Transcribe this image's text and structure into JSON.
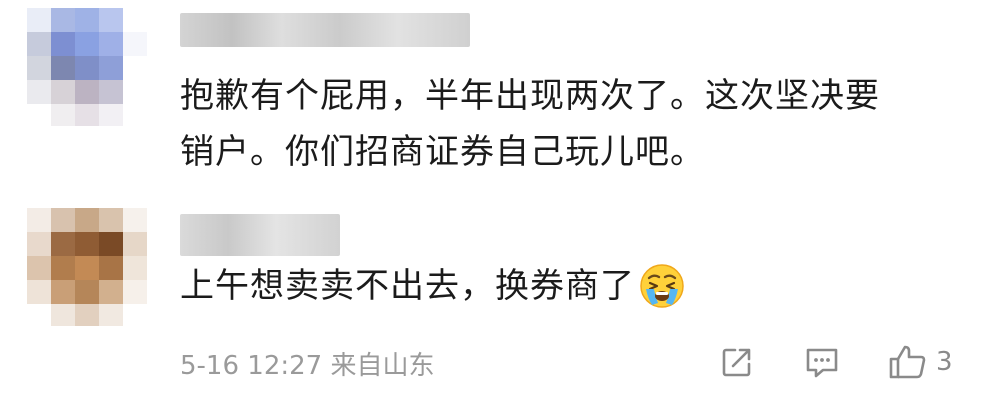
{
  "comments": [
    {
      "lines": [
        "抱歉有个屁用，半年出现两次了。这次坚决要",
        "销户。你们招商证券自己玩儿吧。"
      ]
    },
    {
      "text": "上午想卖卖不出去，换券商了",
      "emoji": "crying-face-emoji",
      "meta": "5-16 12:27 来自山东",
      "like_count": "3"
    }
  ],
  "colors": {
    "text": "#1b1b1b",
    "meta": "#9a9a9a",
    "icon": "#8a8a8a"
  }
}
